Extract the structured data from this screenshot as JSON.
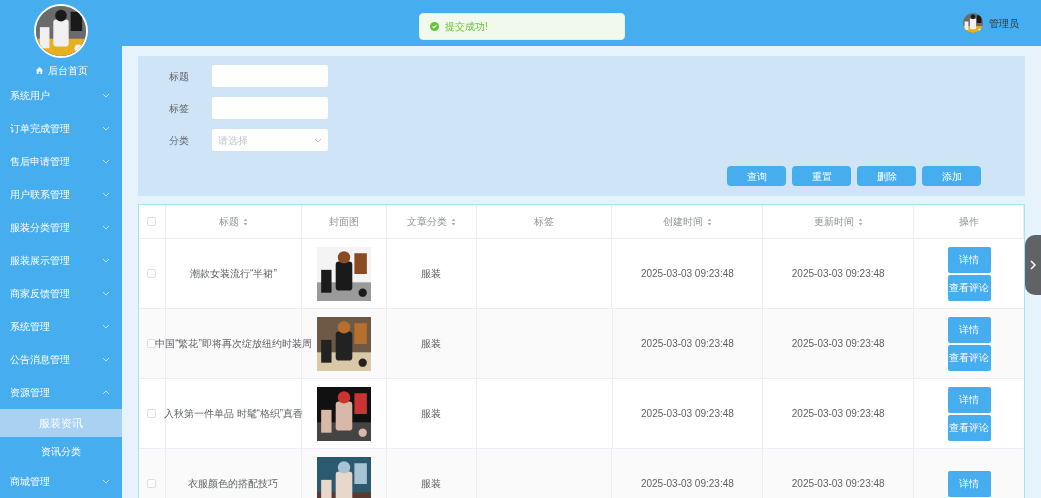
{
  "sidebar": {
    "home": "后台首页",
    "items": [
      {
        "label": "系统用户",
        "expanded": false
      },
      {
        "label": "订单完成管理",
        "expanded": false
      },
      {
        "label": "售后申请管理",
        "expanded": false
      },
      {
        "label": "用户联系管理",
        "expanded": false
      },
      {
        "label": "服装分类管理",
        "expanded": false
      },
      {
        "label": "服装展示管理",
        "expanded": false
      },
      {
        "label": "商家反馈管理",
        "expanded": false
      },
      {
        "label": "系统管理",
        "expanded": false
      },
      {
        "label": "公告消息管理",
        "expanded": false
      },
      {
        "label": "资源管理",
        "expanded": true,
        "children": [
          {
            "label": "服装资讯",
            "selected": true
          },
          {
            "label": "资讯分类",
            "selected": false
          }
        ]
      },
      {
        "label": "商城管理",
        "expanded": false
      }
    ]
  },
  "header": {
    "toast": "提交成功!",
    "user": "管理员"
  },
  "search": {
    "fields": [
      {
        "label": "标题",
        "kind": "input"
      },
      {
        "label": "标签",
        "kind": "input"
      },
      {
        "label": "分类",
        "kind": "select",
        "placeholder": "请选择"
      }
    ],
    "buttons": [
      "查询",
      "重置",
      "删除",
      "添加"
    ]
  },
  "table": {
    "select_all": {
      "checked": false
    },
    "columns": [
      {
        "label": "标题",
        "sortable": true
      },
      {
        "label": "封面图",
        "sortable": false
      },
      {
        "label": "文章分类",
        "sortable": true
      },
      {
        "label": "标签",
        "sortable": false
      },
      {
        "label": "创建时间",
        "sortable": true
      },
      {
        "label": "更新时间",
        "sortable": true
      },
      {
        "label": "操作",
        "sortable": false
      }
    ],
    "rows": [
      {
        "selected": false,
        "title": "潮款女装流行“半裙”",
        "cover": {
          "kind": "picture"
        },
        "category": "服装",
        "created": "2025-03-03 09:23:48",
        "updated": "2025-03-03 09:23:48",
        "actions": [
          "详情",
          "查看评论"
        ]
      },
      {
        "selected": false,
        "title": "中国“繁花”即将再次绽放纽约时装周",
        "cover": {
          "kind": "picture"
        },
        "category": "服装",
        "created": "2025-03-03 09:23:48",
        "updated": "2025-03-03 09:23:48",
        "actions": [
          "详情",
          "查看评论"
        ]
      },
      {
        "selected": false,
        "title": "入秋第一件单品 时髦“格织”真香",
        "cover": {
          "kind": "picture"
        },
        "category": "服装",
        "created": "2025-03-03 09:23:48",
        "updated": "2025-03-03 09:23:48",
        "actions": [
          "详情",
          "查看评论"
        ]
      },
      {
        "selected": false,
        "title": "衣服颜色的搭配技巧",
        "cover": {
          "kind": "picture"
        },
        "category": "服装",
        "created": "2025-03-03 09:23:48",
        "updated": "2025-03-03 09:23:48",
        "actions": [
          "详情"
        ]
      }
    ]
  }
}
